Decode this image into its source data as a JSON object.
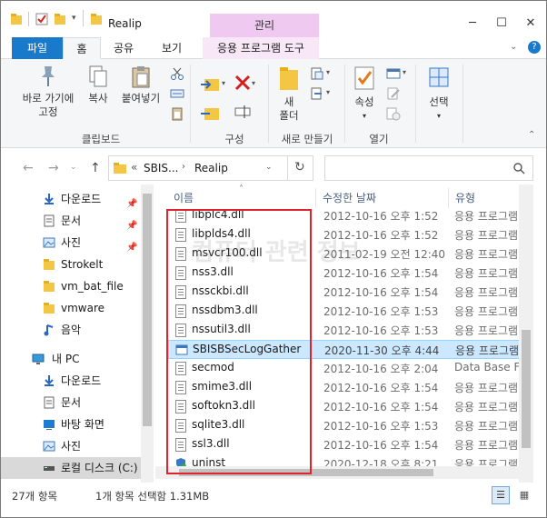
{
  "window": {
    "title": "Realip",
    "context_tab_header": "관리"
  },
  "ribbon_tabs": [
    "파일",
    "홈",
    "공유",
    "보기",
    "응용 프로그램 도구"
  ],
  "ribbon": {
    "pin_label_1": "바로 가기에",
    "pin_label_2": "고정",
    "copy_label": "복사",
    "paste_label": "붙여넣기",
    "group_clipboard": "클립보드",
    "group_organize": "구성",
    "new_folder_1": "새",
    "new_folder_2": "폴더",
    "group_new": "새로 만들기",
    "properties_label": "속성",
    "group_open": "열기",
    "select_label": "선택"
  },
  "address": {
    "prefix": "«",
    "crumbs": [
      "SBIS...",
      "Realip"
    ],
    "search_placeholder": ""
  },
  "nav": {
    "quick": [
      {
        "label": "다운로드",
        "icon": "download-icon",
        "pinned": true
      },
      {
        "label": "문서",
        "icon": "document-icon",
        "pinned": true
      },
      {
        "label": "사진",
        "icon": "picture-icon",
        "pinned": true
      },
      {
        "label": "Strokelt",
        "icon": "folder-icon",
        "pinned": false
      },
      {
        "label": "vm_bat_file",
        "icon": "folder-icon",
        "pinned": false
      },
      {
        "label": "vmware",
        "icon": "folder-icon",
        "pinned": false
      },
      {
        "label": "음악",
        "icon": "music-icon",
        "pinned": false
      }
    ],
    "pc_label": "내 PC",
    "pc_items": [
      {
        "label": "다운로드",
        "icon": "download-icon"
      },
      {
        "label": "문서",
        "icon": "document-icon"
      },
      {
        "label": "바탕 화면",
        "icon": "desktop-icon"
      },
      {
        "label": "사진",
        "icon": "picture-icon"
      },
      {
        "label": "로컬 디스크 (C:)",
        "icon": "drive-icon"
      }
    ]
  },
  "columns": {
    "name": "이름",
    "date": "수정한 날짜",
    "type": "유형"
  },
  "files": [
    {
      "name": "libplc4.dll",
      "date": "2012-10-16 오후 1:52",
      "type": "응용 프로그램"
    },
    {
      "name": "libplds4.dll",
      "date": "2012-10-16 오후 1:52",
      "type": "응용 프로그램"
    },
    {
      "name": "msvcr100.dll",
      "date": "2011-02-19 오전 12:40",
      "type": "응용 프로그램"
    },
    {
      "name": "nss3.dll",
      "date": "2012-10-16 오후 1:54",
      "type": "응용 프로그램"
    },
    {
      "name": "nssckbi.dll",
      "date": "2012-10-16 오후 1:54",
      "type": "응용 프로그램"
    },
    {
      "name": "nssdbm3.dll",
      "date": "2012-10-16 오후 1:53",
      "type": "응용 프로그램"
    },
    {
      "name": "nssutil3.dll",
      "date": "2012-10-16 오후 1:53",
      "type": "응용 프로그램"
    },
    {
      "name": "SBISBSecLogGather",
      "date": "2020-11-30 오후 4:44",
      "type": "응용 프로그램",
      "selected": true
    },
    {
      "name": "secmod",
      "date": "2012-10-16 오후 2:04",
      "type": "Data Base File"
    },
    {
      "name": "smime3.dll",
      "date": "2012-10-16 오후 1:54",
      "type": "응용 프로그램"
    },
    {
      "name": "softokn3.dll",
      "date": "2012-10-16 오후 1:54",
      "type": "응용 프로그램"
    },
    {
      "name": "sqlite3.dll",
      "date": "2012-10-16 오후 1:53",
      "type": "응용 프로그램"
    },
    {
      "name": "ssl3.dll",
      "date": "2012-10-16 오후 1:54",
      "type": "응용 프로그램"
    },
    {
      "name": "uninst",
      "date": "2020-12-18 오후 8:21",
      "type": "응용 프로그램"
    }
  ],
  "watermark": "컴퓨터 관련 정보",
  "status": {
    "item_count": "27개 항목",
    "selection": "1개 항목 선택함 1.31MB"
  },
  "colors": {
    "accent": "#1979ca",
    "context_tab": "#f0c9f0",
    "selection": "#cce8ff",
    "highlight_box": "#e0242b"
  }
}
